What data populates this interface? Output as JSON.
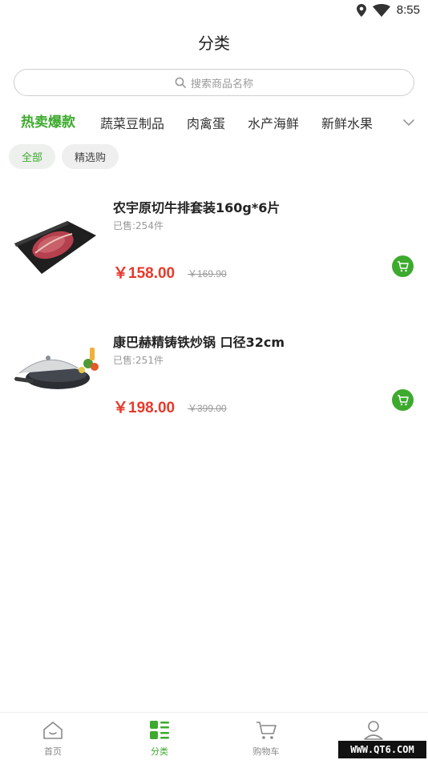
{
  "status_bar": {
    "time": "8:55",
    "icons": [
      "location-icon",
      "wifi-icon"
    ]
  },
  "page": {
    "title": "分类"
  },
  "search": {
    "placeholder": "搜索商品名称",
    "icon": "search-icon"
  },
  "categories": [
    {
      "label": "热卖爆款",
      "active": true
    },
    {
      "label": "蔬菜豆制品",
      "active": false
    },
    {
      "label": "肉禽蛋",
      "active": false
    },
    {
      "label": "水产海鲜",
      "active": false
    },
    {
      "label": "新鲜水果",
      "active": false
    }
  ],
  "filters": [
    {
      "label": "全部",
      "active": true
    },
    {
      "label": "精选购",
      "active": false
    }
  ],
  "products": [
    {
      "name": "农宇原切牛排套装160g*6片",
      "sold": "已售:254件",
      "price": "￥158.00",
      "original_price": "￥169.90",
      "image": "steak-image"
    },
    {
      "name": "康巴赫精铸铁炒锅 口径32cm",
      "sold": "已售:251件",
      "price": "￥198.00",
      "original_price": "￥399.00",
      "image": "wok-image"
    }
  ],
  "tabbar": [
    {
      "label": "首页",
      "icon": "home-icon",
      "active": false
    },
    {
      "label": "分类",
      "icon": "category-icon",
      "active": true
    },
    {
      "label": "购物车",
      "icon": "cart-icon",
      "active": false
    },
    {
      "label": "",
      "icon": "user-icon",
      "active": false
    }
  ],
  "watermark": "WWW.QT6.COM",
  "colors": {
    "accent": "#3daa2e",
    "price": "#e8392a"
  }
}
